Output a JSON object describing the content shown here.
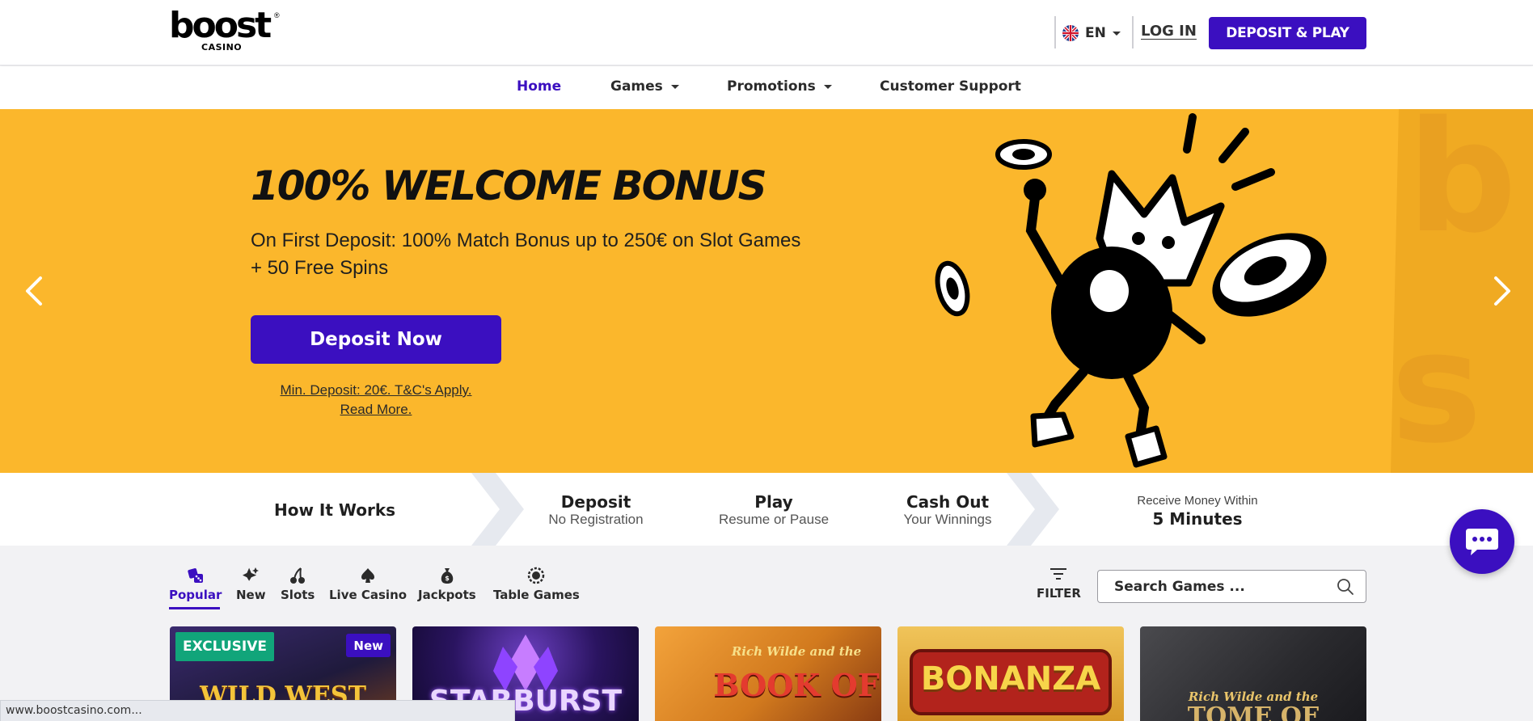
{
  "brand": {
    "logo_word": "boost",
    "logo_sub": "CASINO",
    "logo_mark": "®"
  },
  "header": {
    "language": "EN",
    "login_label": "LOG IN",
    "deposit_play_label": "DEPOSIT & PLAY"
  },
  "nav": {
    "items": [
      {
        "label": "Home",
        "active": true
      },
      {
        "label": "Games",
        "dropdown": true
      },
      {
        "label": "Promotions",
        "dropdown": true
      },
      {
        "label": "Customer Support"
      }
    ]
  },
  "hero": {
    "title": "100% WELCOME BONUS",
    "subtitle": "On First Deposit: 100% Match Bonus up to 250€ on Slot Games + 50 Free Spins",
    "cta_label": "Deposit Now",
    "terms_line1": "Min. Deposit: 20€. T&C's Apply.",
    "terms_line2": "Read More."
  },
  "how": {
    "title": "How It Works",
    "steps": [
      {
        "title": "Deposit",
        "sub": "No Registration"
      },
      {
        "title": "Play",
        "sub": "Resume or Pause"
      },
      {
        "title": "Cash Out",
        "sub": "Your Winnings"
      }
    ],
    "receive_sub": "Receive Money Within",
    "receive_title": "5 Minutes"
  },
  "categories": {
    "items": [
      {
        "label": "Popular",
        "icon": "dice-icon",
        "active": true
      },
      {
        "label": "New",
        "icon": "sparkle-icon"
      },
      {
        "label": "Slots",
        "icon": "cherry-icon"
      },
      {
        "label": "Live Casino",
        "icon": "spade-icon"
      },
      {
        "label": "Jackpots",
        "icon": "money-bag-icon"
      },
      {
        "label": "Table Games",
        "icon": "roulette-icon"
      }
    ],
    "filter_label": "FILTER",
    "search_placeholder": "Search Games ..."
  },
  "games": [
    {
      "name": "WILD WEST",
      "badge": "EXCLUSIVE",
      "badge2": "New"
    },
    {
      "name": "STARBURST"
    },
    {
      "name": "BOOK OF",
      "prefix": "Rich Wilde and the"
    },
    {
      "name": "BONANZA"
    },
    {
      "name": "TOME OF",
      "prefix": "Rich Wilde and the"
    }
  ],
  "statusbar": {
    "url": "www.boostcasino.com..."
  },
  "colors": {
    "accent": "#3b0fc0",
    "hero_bg": "#fbb72c",
    "exclusive_badge": "#11a57a"
  }
}
